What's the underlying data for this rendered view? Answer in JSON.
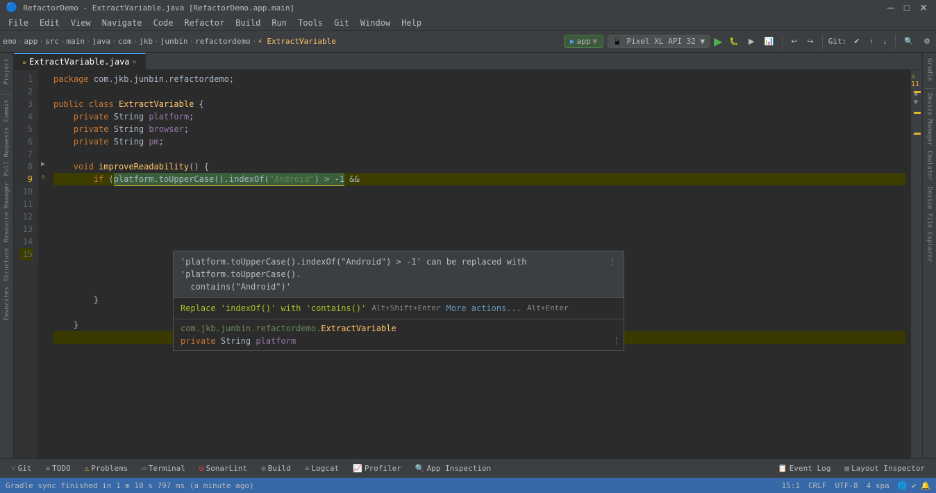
{
  "titleBar": {
    "title": "RefactorDemo - ExtractVariable.java [RefactorDemo.app.main]",
    "controls": [
      "─",
      "□",
      "✕"
    ]
  },
  "menuBar": {
    "items": [
      "File",
      "Edit",
      "View",
      "Navigate",
      "Code",
      "Refactor",
      "Build",
      "Run",
      "Tools",
      "Git",
      "Window",
      "Help"
    ]
  },
  "toolbar": {
    "breadcrumbs": [
      "emo",
      "app",
      "src",
      "main",
      "java",
      "com",
      "jkb",
      "junbin",
      "refactordemo",
      "ExtractVariable"
    ],
    "appSelector": "app",
    "deviceSelector": "Pixel XL API 32"
  },
  "fileTab": {
    "name": "ExtractVariable.java",
    "active": true
  },
  "code": {
    "lines": [
      {
        "num": 1,
        "text": "package com.jkb.junbin.refactordemo;",
        "highlight": false
      },
      {
        "num": 2,
        "text": "",
        "highlight": false
      },
      {
        "num": 3,
        "text": "public class ExtractVariable {",
        "highlight": false
      },
      {
        "num": 4,
        "text": "    private String platform;",
        "highlight": false
      },
      {
        "num": 5,
        "text": "    private String browser;",
        "highlight": false
      },
      {
        "num": 6,
        "text": "    private String pm;",
        "highlight": false
      },
      {
        "num": 7,
        "text": "",
        "highlight": false
      },
      {
        "num": 8,
        "text": "    void improveReadability() {",
        "highlight": false
      },
      {
        "num": 9,
        "text": "        if (platform.toUpperCase().indexOf(\"Android\") > -1 &&",
        "highlight": true
      },
      {
        "num": 10,
        "text": "",
        "highlight": false
      },
      {
        "num": 11,
        "text": "",
        "highlight": false
      },
      {
        "num": 12,
        "text": "        }",
        "highlight": false
      },
      {
        "num": 13,
        "text": "",
        "highlight": false
      },
      {
        "num": 14,
        "text": "    }",
        "highlight": false
      },
      {
        "num": 15,
        "text": "",
        "highlight": true
      }
    ]
  },
  "popup": {
    "suggestion": "'platform.toUpperCase().indexOf(\"Android\") > -1' can be replaced with 'platform.toUpperCase().contains(\"Android\")'",
    "action": "Replace 'indexOf()' with 'contains()'",
    "shortcut": "Alt+Shift+Enter",
    "moreActions": "More actions...",
    "moreActionsShortcut": "Alt+Enter",
    "contextClass": "com.jkb.junbin.refactordemo.ExtractVariable",
    "contextField": "private String platform"
  },
  "bottomTabs": [
    {
      "label": "Git",
      "icon": "git"
    },
    {
      "label": "TODO",
      "icon": "list"
    },
    {
      "label": "Problems",
      "icon": "warning"
    },
    {
      "label": "Terminal",
      "icon": "terminal"
    },
    {
      "label": "SonarLint",
      "icon": "sonar"
    },
    {
      "label": "Build",
      "icon": "build"
    },
    {
      "label": "Logcat",
      "icon": "log"
    },
    {
      "label": "Profiler",
      "icon": "profiler"
    },
    {
      "label": "App Inspection",
      "icon": "inspect"
    },
    {
      "label": "Event Log",
      "icon": "event"
    },
    {
      "label": "Layout Inspector",
      "icon": "layout"
    }
  ],
  "statusBar": {
    "message": "Gradle sync finished in 1 m 10 s 797 ms (a minute ago)",
    "position": "15:1",
    "encoding": "CRLF",
    "charset": "UTF-8",
    "indent": "4 spa",
    "warnings": "11"
  },
  "sidebarLabels": {
    "left": [
      "Project",
      "Commit",
      "Pull Requests",
      "Resource Manager",
      "Structure",
      "Favorites"
    ],
    "right": [
      "Gradle",
      "Device Manager",
      "Emulator",
      "Device File Explorer"
    ]
  }
}
